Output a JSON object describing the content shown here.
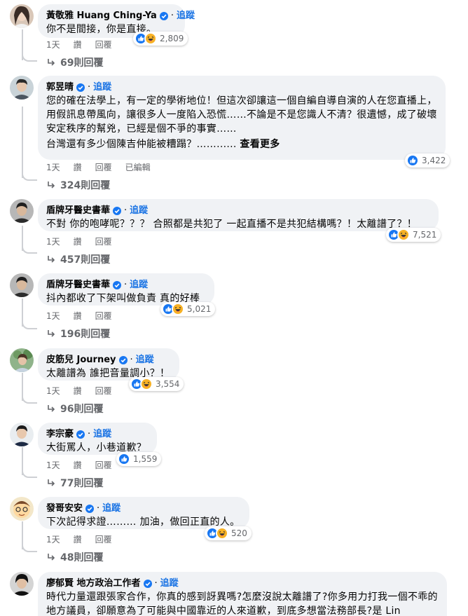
{
  "follow_label": "追蹤",
  "comments": [
    {
      "name": "黃敬雅 Huang Ching-Ya",
      "text": [
        "你不是間接，你是直接。"
      ],
      "time": "1天",
      "like": "讚",
      "reply": "回覆",
      "reactions": "2,809",
      "reaction_icons": [
        "like-icon",
        "haha-icon"
      ],
      "replies": "69則回覆"
    },
    {
      "name": "郭昱晴",
      "text": [
        "您的確在法學上，有一定的學術地位！但這次卻讓這一個自編自導自演的人在您直播上，用假訊息帶風向，讓很多人一度陷入恐慌……不論是不是您識人不清？很遺憾，成了破壞安定秩序的幫兇，已經是個不爭的事實……",
        "台灣還有多少個陳吉仲能被糟蹋？……"
      ],
      "ellipsis": "......",
      "see_more": "查看更多",
      "time": "1天",
      "like": "讚",
      "reply": "回覆",
      "edited": "已編輯",
      "reactions": "3,422",
      "reaction_icons": [
        "like-icon"
      ],
      "replies": "324則回覆"
    },
    {
      "name": "盾牌牙醫史書華",
      "text": [
        "不對 你的咆哮呢？？？ 合照都是共犯了 一起直播不是共犯結構嗎？！太離譜了？！"
      ],
      "time": "1天",
      "like": "讚",
      "reply": "回覆",
      "reactions": "7,521",
      "reaction_icons": [
        "like-icon",
        "haha-icon"
      ],
      "replies": "457則回覆"
    },
    {
      "name": "盾牌牙醫史書華",
      "text": [
        "抖內都收了下架叫做負責 真的好棒"
      ],
      "time": "1天",
      "like": "讚",
      "reply": "回覆",
      "reactions": "5,021",
      "reaction_icons": [
        "like-icon",
        "haha-icon"
      ],
      "replies": "196則回覆"
    },
    {
      "name": "皮筋兒 Journey",
      "text": [
        "太離譜為 誰把音量調小？！"
      ],
      "time": "1天",
      "like": "讚",
      "reply": "回覆",
      "reactions": "3,554",
      "reaction_icons": [
        "like-icon",
        "haha-icon"
      ],
      "replies": "96則回覆"
    },
    {
      "name": "李宗豪",
      "text": [
        "大街罵人，小巷道歉？"
      ],
      "time": "1天",
      "like": "讚",
      "reply": "回覆",
      "reactions": "1,559",
      "reaction_icons": [
        "like-icon"
      ],
      "replies": "77則回覆"
    },
    {
      "name": "發哥安安",
      "text": [
        "下次記得求證……… 加油，做回正直的人。"
      ],
      "time": "1天",
      "like": "讚",
      "reply": "回覆",
      "reactions": "520",
      "reaction_icons": [
        "like-icon",
        "haha-icon"
      ],
      "replies": "48則回覆"
    },
    {
      "name": "廖郁賢 地方政治工作者",
      "text": [
        "時代力量還跟張家合作，你真的感到訝異嗎?怎麼沒說太離譜了?你多用力打我一個不乖的地方議員，卻願意為了可能與中國靠近的人來道歉，到底多想當法務部長?是 Lin"
      ]
    }
  ]
}
